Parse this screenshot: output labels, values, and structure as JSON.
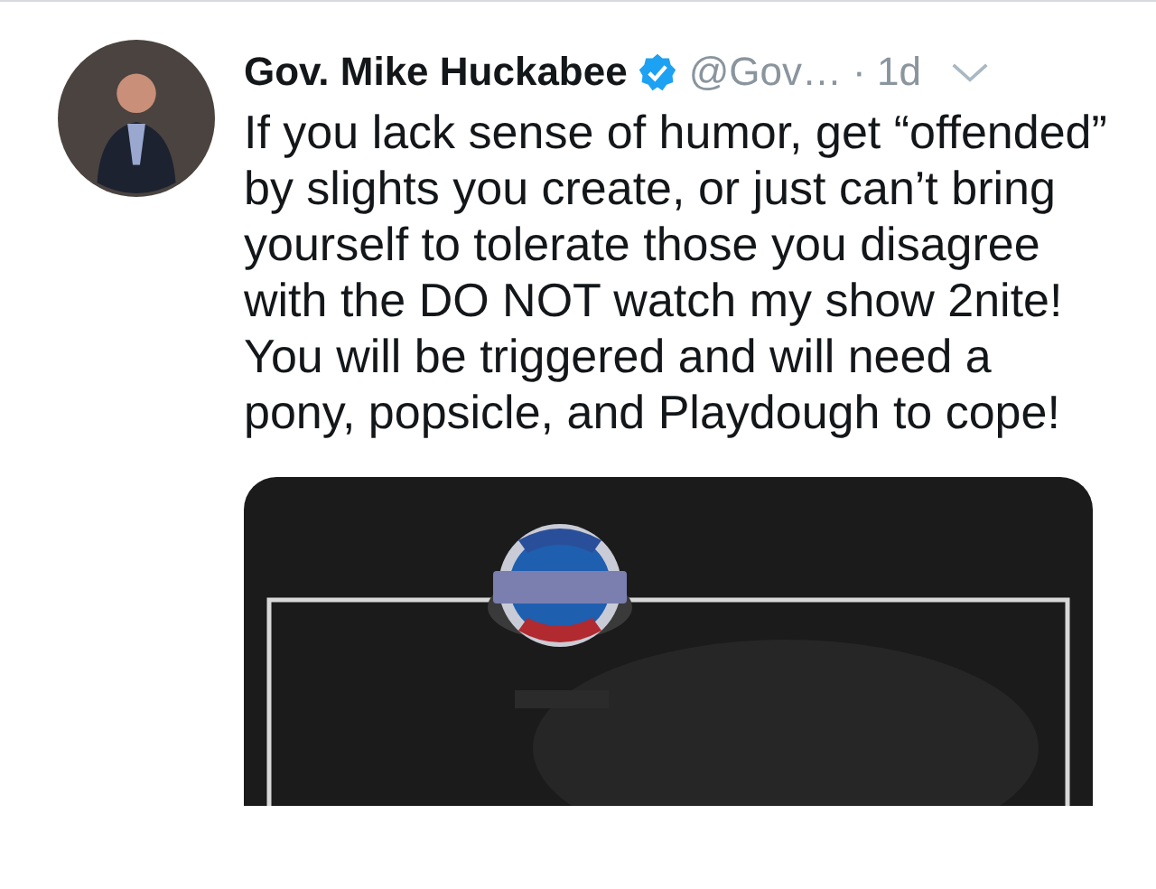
{
  "tweet": {
    "name": "Gov. Mike Huckabee",
    "verified": true,
    "handle": "@Gov…",
    "time": "· 1d",
    "text": "If you lack sense of humor, get “offended” by slights you create, or just can’t bring yourself to tolerate those you disagree with the DO NOT watch my show 2nite!  You will be triggered and will need a pony, popsicle, and Playdough to cope!"
  }
}
